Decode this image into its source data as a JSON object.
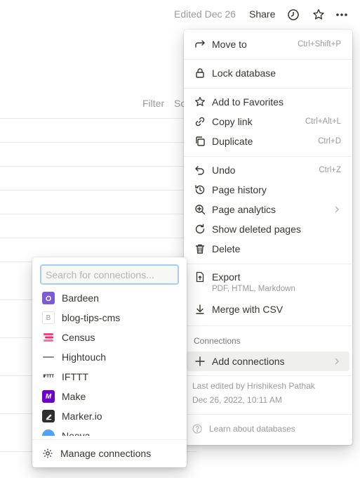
{
  "topbar": {
    "edited": "Edited Dec 26",
    "share": "Share",
    "icons": [
      "clock-icon",
      "star-icon",
      "more-icon"
    ]
  },
  "table": {
    "filter": "Filter",
    "sort": "So"
  },
  "menu": {
    "move_to": {
      "label": "Move to",
      "shortcut": "Ctrl+Shift+P"
    },
    "lock": {
      "label": "Lock database"
    },
    "favorites": {
      "label": "Add to Favorites"
    },
    "copy_link": {
      "label": "Copy link",
      "shortcut": "Ctrl+Alt+L"
    },
    "duplicate": {
      "label": "Duplicate",
      "shortcut": "Ctrl+D"
    },
    "undo": {
      "label": "Undo",
      "shortcut": "Ctrl+Z"
    },
    "page_history": {
      "label": "Page history"
    },
    "page_analytics": {
      "label": "Page analytics"
    },
    "show_deleted": {
      "label": "Show deleted pages"
    },
    "delete": {
      "label": "Delete"
    },
    "export": {
      "label": "Export",
      "sub": "PDF, HTML, Markdown"
    },
    "merge": {
      "label": "Merge with CSV"
    },
    "connections_heading": "Connections",
    "add_connections": {
      "label": "Add connections"
    },
    "last_edited_by": "Last edited by Hrishikesh Pathak",
    "last_edited_date": "Dec 26, 2022, 10:11 AM",
    "learn": "Learn about databases"
  },
  "connections": {
    "search_placeholder": "Search for connections...",
    "items": [
      {
        "name": "Bardeen",
        "logo_bg": "#7c5cd6",
        "logo_color": "#ffffff",
        "logo_text": ""
      },
      {
        "name": "blog-tips-cms",
        "logo_bg": "#ffffff",
        "logo_color": "#9b9a97",
        "logo_text": "B"
      },
      {
        "name": "Census",
        "logo_bg": "#ffffff",
        "logo_color": "#e5306d",
        "logo_text": ""
      },
      {
        "name": "Hightouch",
        "logo_bg": "#ffffff",
        "logo_color": "#555555",
        "logo_text": ""
      },
      {
        "name": "IFTTT",
        "logo_bg": "#ffffff",
        "logo_color": "#111111",
        "logo_text": "IFTTT"
      },
      {
        "name": "Make",
        "logo_bg": "#6d00cc",
        "logo_color": "#ffffff",
        "logo_text": "M"
      },
      {
        "name": "Marker.io",
        "logo_bg": "#2f2f2f",
        "logo_color": "#ffffff",
        "logo_text": ""
      },
      {
        "name": "Neeva",
        "logo_bg": "#4fa3f7",
        "logo_color": "#ffffff",
        "logo_text": ""
      }
    ],
    "manage": "Manage connections"
  }
}
